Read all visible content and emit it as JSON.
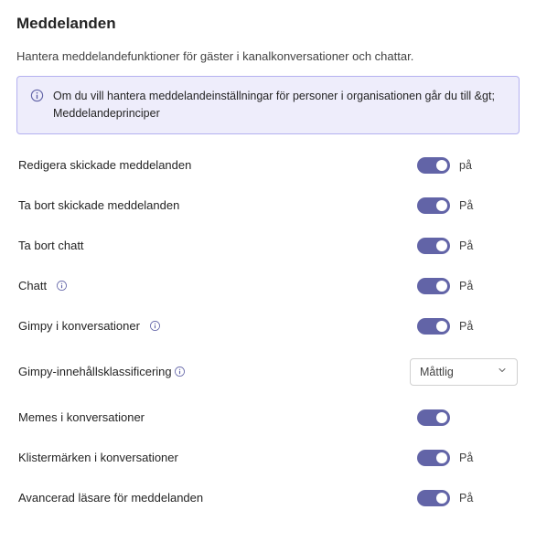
{
  "page": {
    "title": "Meddelanden",
    "subtitle": "Hantera meddelandefunktioner för gäster i kanalkonversationer och chattar."
  },
  "banner": {
    "text": "Om du vill hantera meddelandeinställningar för personer i organisationen går du till &gt; Meddelandeprinciper"
  },
  "settings": {
    "edit_sent": {
      "label": "Redigera skickade meddelanden",
      "status": "på"
    },
    "delete_sent": {
      "label": "Ta bort skickade meddelanden",
      "status": "På"
    },
    "delete_chat": {
      "label": "Ta bort chatt",
      "status": "På"
    },
    "chat": {
      "label": "Chatt",
      "status": "På"
    },
    "gimpy_conv": {
      "label": "Gimpy i konversationer",
      "status": "På"
    },
    "gimpy_class": {
      "label": "Gimpy-innehållsklassificering",
      "selected": "Måttlig"
    },
    "memes": {
      "label": "Memes i konversationer",
      "status": ""
    },
    "stickers": {
      "label": "Klistermärken i konversationer",
      "status": "På"
    },
    "immersive": {
      "label": "Avancerad läsare för meddelanden",
      "status": "På"
    }
  },
  "colors": {
    "accent": "#6264a7",
    "banner_bg": "#eeedfb",
    "banner_border": "#b4b1f0"
  }
}
